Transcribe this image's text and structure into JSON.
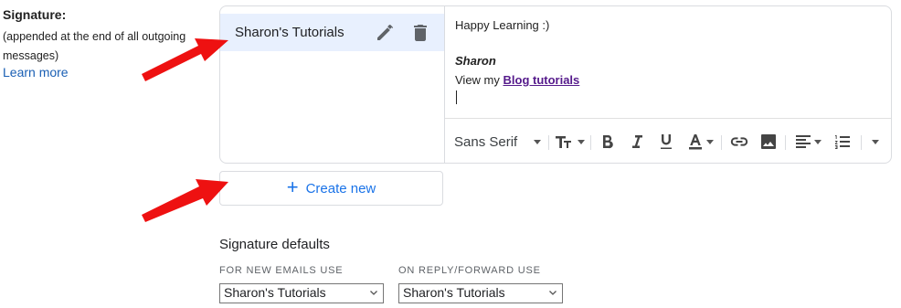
{
  "left": {
    "heading": "Signature:",
    "subtext": "(appended at the end of all outgoing messages)",
    "learn_more": "Learn more"
  },
  "signatures": {
    "items": [
      {
        "name": "Sharon's Tutorials",
        "selected": true
      }
    ],
    "edit_icon": "pencil-icon",
    "delete_icon": "trash-icon"
  },
  "editor": {
    "line1": "Happy Learning :)",
    "name": "Sharon",
    "line3_prefix": "View my ",
    "link_text": "Blog tutorials"
  },
  "toolbar": {
    "font": "Sans Serif",
    "icons": [
      "font-dropdown",
      "text-size-icon",
      "bold-icon",
      "italic-icon",
      "underline-icon",
      "text-color-icon",
      "link-icon",
      "image-icon",
      "align-icon",
      "numbered-list-icon",
      "more-formatting-icon"
    ]
  },
  "create_button": {
    "label": "Create new",
    "icon": "plus-icon"
  },
  "defaults": {
    "title": "Signature defaults",
    "new_label": "FOR NEW EMAILS USE",
    "new_value": "Sharon's Tutorials",
    "reply_label": "ON REPLY/FORWARD USE",
    "reply_value": "Sharon's Tutorials"
  },
  "annotations": {
    "arrow_color": "#ee1111",
    "arrow_count": 2
  },
  "colors": {
    "accent": "#1a73e8",
    "selected_bg": "#e8f0fe",
    "link": "#1a5fb4",
    "visited_link": "#551a8b"
  }
}
